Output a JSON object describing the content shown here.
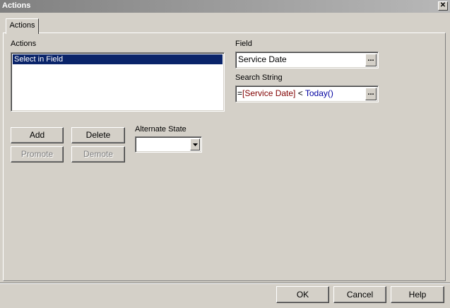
{
  "window": {
    "title": "Actions",
    "close_symbol": "✕"
  },
  "tabs": [
    {
      "label": "Actions"
    }
  ],
  "actions": {
    "label": "Actions",
    "items": [
      "Select in Field"
    ],
    "selected_index": 0
  },
  "buttons": {
    "add": "Add",
    "delete": "Delete",
    "promote": "Promote",
    "demote": "Demote"
  },
  "alternate_state": {
    "label": "Alternate State",
    "value": ""
  },
  "field": {
    "label": "Field",
    "value": "Service Date",
    "browse": "..."
  },
  "search_string": {
    "label": "Search String",
    "tokens": {
      "eq": "=",
      "field": "[Service Date]",
      "op": " < ",
      "fn": "Today()"
    },
    "browse": "..."
  },
  "footer": {
    "ok": "OK",
    "cancel": "Cancel",
    "help": "Help"
  }
}
